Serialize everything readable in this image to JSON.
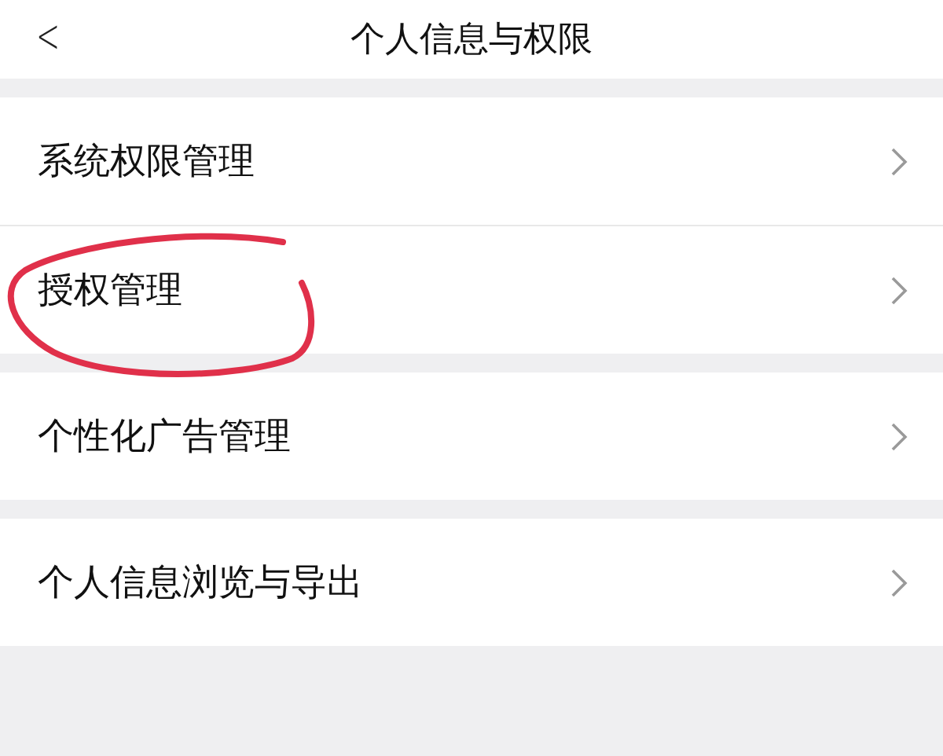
{
  "header": {
    "back": "<",
    "title": "个人信息与权限"
  },
  "groups": [
    [
      {
        "label": "系统权限管理",
        "circled": false
      },
      {
        "label": "授权管理",
        "circled": true
      }
    ],
    [
      {
        "label": "个性化广告管理",
        "circled": false
      }
    ],
    [
      {
        "label": "个人信息浏览与导出",
        "circled": false
      }
    ]
  ]
}
